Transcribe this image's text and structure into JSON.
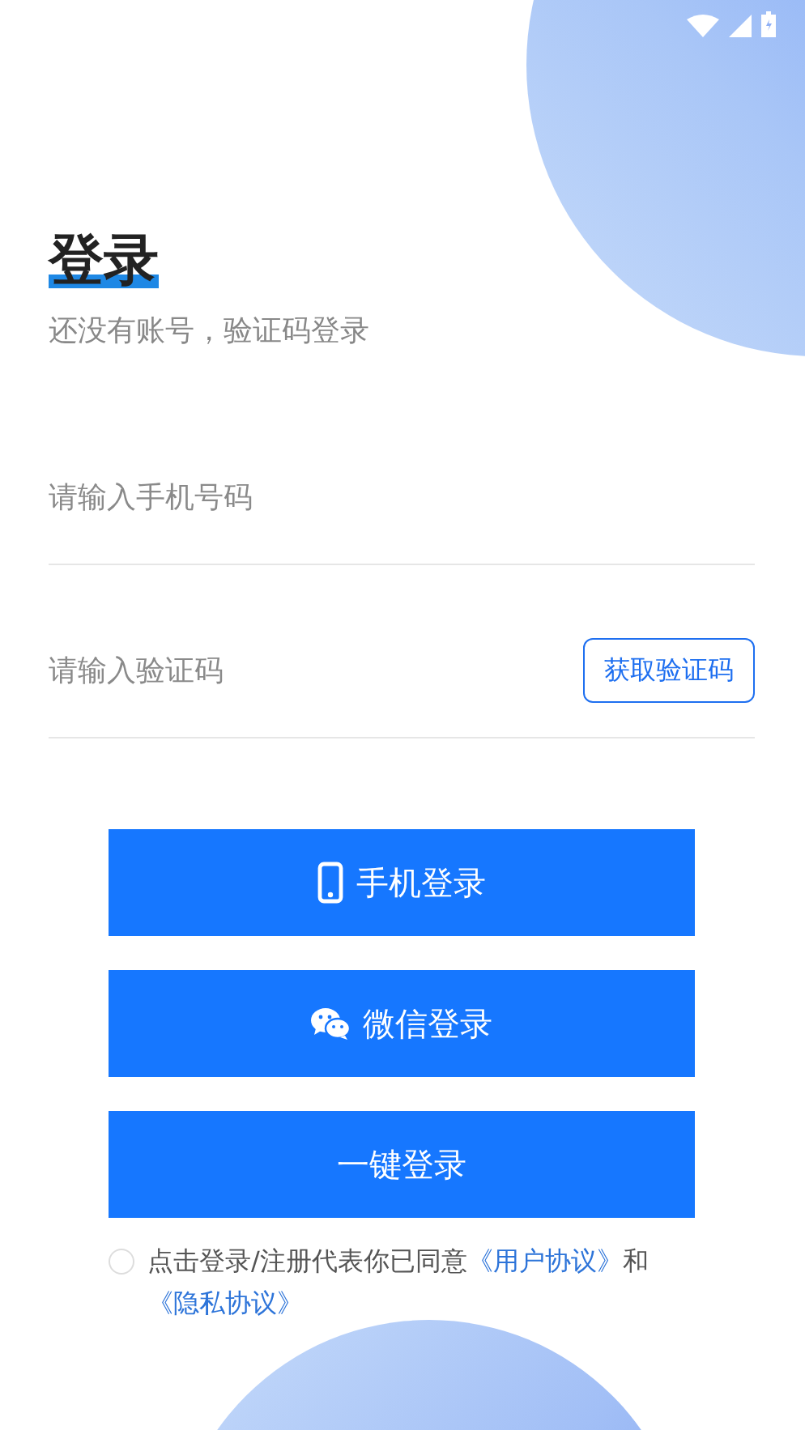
{
  "title": "登录",
  "subtitle": "还没有账号，验证码登录",
  "fields": [
    {
      "placeholder": "请输入手机号码"
    },
    {
      "placeholder": "请输入验证码",
      "action": "获取验证码"
    }
  ],
  "buttons": [
    {
      "kind": "phone",
      "label": "手机登录"
    },
    {
      "kind": "wechat",
      "label": "微信登录"
    },
    {
      "kind": "plain",
      "label": "一键登录"
    }
  ],
  "agreement": {
    "checked": false,
    "segments": [
      {
        "kind": "text",
        "text": "点击登录/注册代表你已同意"
      },
      {
        "kind": "link",
        "text": "《用户协议》"
      },
      {
        "kind": "text",
        "text": "和"
      },
      {
        "kind": "link",
        "text": "《隐私协议》"
      }
    ]
  }
}
